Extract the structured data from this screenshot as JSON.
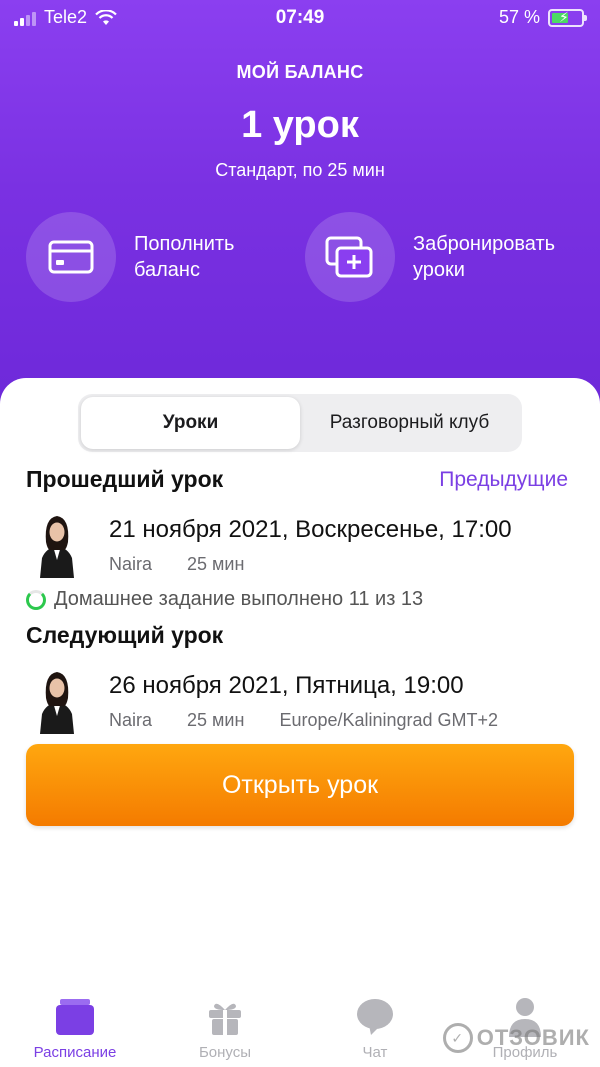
{
  "status_bar": {
    "carrier": "Tele2",
    "time": "07:49",
    "battery": "57 %",
    "battery_level": 0.57
  },
  "balance": {
    "title": "МОЙ БАЛАНС",
    "value": "1 урок",
    "subtitle": "Стандарт, по 25 мин"
  },
  "actions": [
    {
      "label": "Пополнить баланс",
      "icon": "card-icon"
    },
    {
      "label": "Забронировать уроки",
      "icon": "add-lessons-icon"
    }
  ],
  "tabs_segment": [
    {
      "label": "Уроки",
      "active": true
    },
    {
      "label": "Разговорный клуб",
      "active": false
    }
  ],
  "past": {
    "title": "Прошедший урок",
    "link": "Предыдущие",
    "date": "21 ноября 2021, Воскресенье, 17:00",
    "teacher": "Naira",
    "duration": "25 мин",
    "homework": "Домашнее задание выполнено 11 из 13"
  },
  "next": {
    "title": "Следующий урок",
    "date": "26 ноября 2021, Пятница, 19:00",
    "teacher": "Naira",
    "duration": "25 мин",
    "timezone": "Europe/Kaliningrad GMT+2"
  },
  "open_button": "Открыть урок",
  "tabbar": [
    {
      "label": "Расписание",
      "icon": "calendar-icon",
      "active": true
    },
    {
      "label": "Бонусы",
      "icon": "gift-icon",
      "active": false
    },
    {
      "label": "Чат",
      "icon": "chat-icon",
      "active": false
    },
    {
      "label": "Профиль",
      "icon": "profile-icon",
      "active": false
    }
  ],
  "watermark": "ОТЗОВИК",
  "colors": {
    "header": "#7a31e2",
    "accent": "#7b3fe4",
    "button": "#f68a00",
    "success": "#2cc84d"
  }
}
